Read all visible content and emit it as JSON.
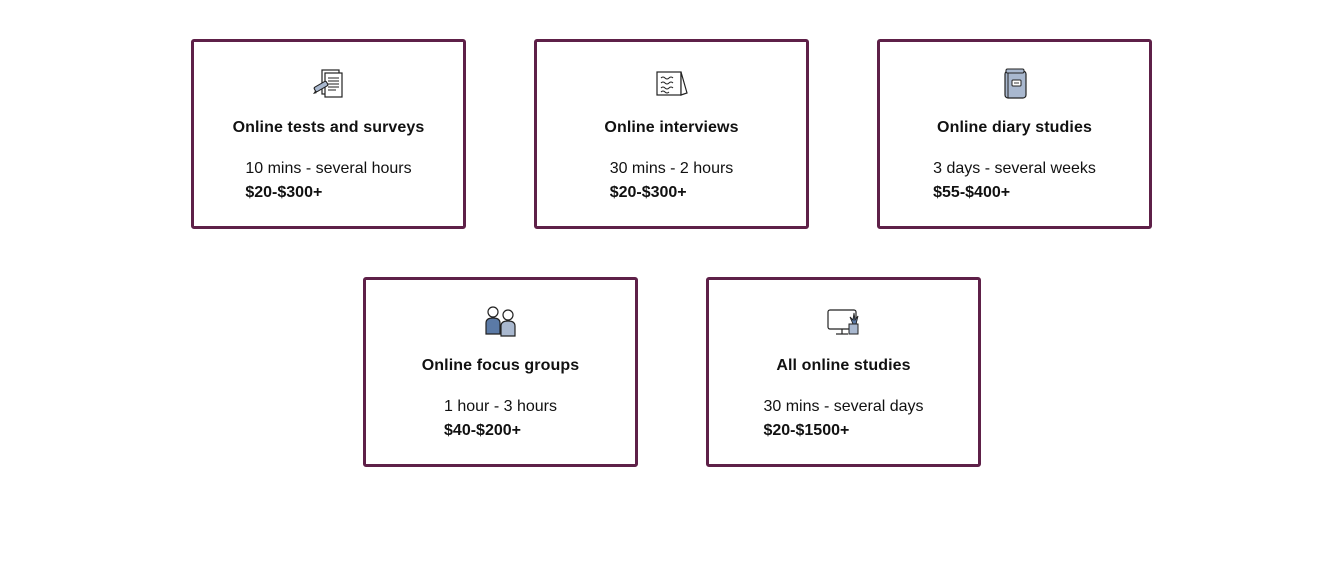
{
  "colors": {
    "card_border": "#5e2048",
    "icon_fill": "#a9b8cf",
    "icon_dark": "#5b7aa6",
    "text": "#111111"
  },
  "cards": [
    {
      "icon": "survey-document-icon",
      "title": "Online tests and surveys",
      "duration": "10 mins - several hours",
      "price": "$20-$300+"
    },
    {
      "icon": "interview-notepad-icon",
      "title": "Online interviews",
      "duration": "30 mins - 2 hours",
      "price": "$20-$300+"
    },
    {
      "icon": "diary-notebook-icon",
      "title": "Online diary studies",
      "duration": "3 days - several weeks",
      "price": "$55-$400+"
    },
    {
      "icon": "people-group-icon",
      "title": "Online focus groups",
      "duration": "1 hour - 3 hours",
      "price": "$40-$200+"
    },
    {
      "icon": "computer-monitor-icon",
      "title": "All online studies",
      "duration": "30 mins - several days",
      "price": "$20-$1500+"
    }
  ]
}
